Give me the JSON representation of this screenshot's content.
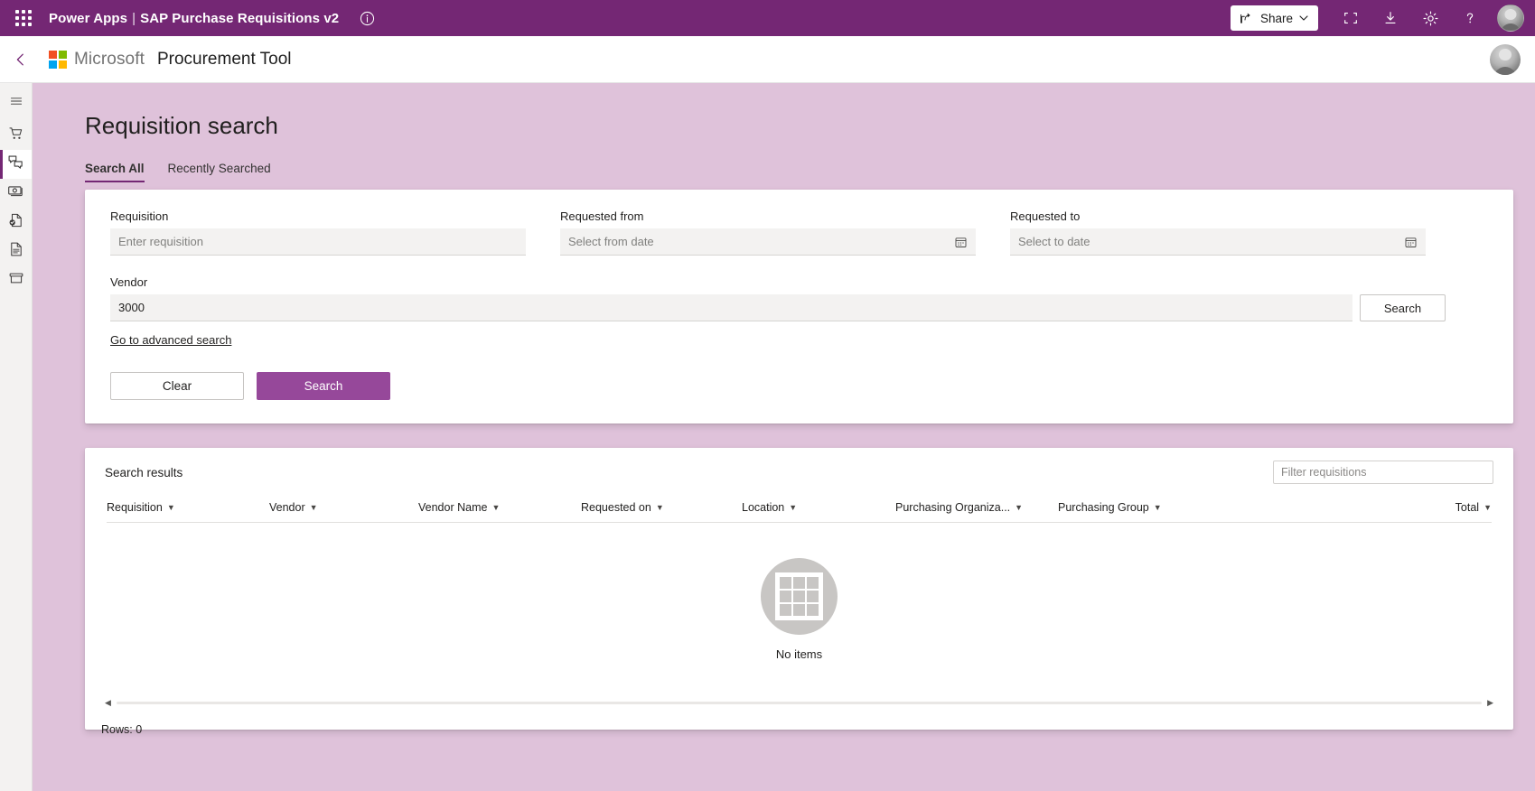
{
  "topbar": {
    "waffle_icon": "waffle-grid-icon",
    "product": "Power Apps",
    "separator": "|",
    "app_name": "SAP Purchase Requisitions v2",
    "info_icon": "info-circle-icon",
    "share_label": "Share",
    "share_icon": "share-arrow-icon",
    "share_chevron": "chevron-down-icon",
    "fullscreen_icon": "fullscreen-icon",
    "download_icon": "download-icon",
    "settings_icon": "gear-icon",
    "help_icon": "help-question-icon",
    "avatar": "user-avatar",
    "background_color": "#742774"
  },
  "appheader": {
    "back_icon": "back-chevron-icon",
    "logo": "microsoft-logo",
    "brand": "Microsoft",
    "tool_name": "Procurement Tool",
    "avatar": "user-avatar"
  },
  "sidebar": {
    "items": [
      {
        "name": "hamburger-menu",
        "icon": "hamburger-icon",
        "active": false
      },
      {
        "name": "shopping-cart",
        "icon": "cart-icon",
        "active": false
      },
      {
        "name": "requisitions",
        "icon": "speech-bubbles-icon",
        "active": true
      },
      {
        "name": "payments",
        "icon": "money-bill-icon",
        "active": false
      },
      {
        "name": "approved-document",
        "icon": "document-check-icon",
        "active": false
      },
      {
        "name": "document-list",
        "icon": "document-lines-icon",
        "active": false
      },
      {
        "name": "archive",
        "icon": "archive-box-icon",
        "active": false
      }
    ]
  },
  "main": {
    "page_title": "Requisition search",
    "tabs": [
      {
        "label": "Search All",
        "active": true
      },
      {
        "label": "Recently Searched",
        "active": false
      }
    ],
    "search_form": {
      "requisition": {
        "label": "Requisition",
        "placeholder": "Enter requisition",
        "value": ""
      },
      "requested_from": {
        "label": "Requested from",
        "placeholder": "Select from date",
        "value": "",
        "icon": "calendar-icon"
      },
      "requested_to": {
        "label": "Requested to",
        "placeholder": "Select to date",
        "value": "",
        "icon": "calendar-icon"
      },
      "vendor": {
        "label": "Vendor",
        "placeholder": "",
        "value": "3000"
      },
      "vendor_search_label": "Search",
      "advanced_link": "Go to advanced search",
      "clear_label": "Clear",
      "search_label": "Search",
      "primary_color": "#96489a"
    },
    "results": {
      "title": "Search results",
      "filter_placeholder": "Filter requisitions",
      "columns": [
        "Requisition",
        "Vendor",
        "Vendor Name",
        "Requested on",
        "Location",
        "Purchasing Organiza...",
        "Purchasing Group",
        "Total"
      ],
      "rows": [],
      "empty_text": "No items",
      "empty_icon": "grid-placeholder-icon",
      "scroll_left_icon": "triangle-left-icon",
      "scroll_right_icon": "triangle-right-icon",
      "rows_count_label": "Rows: 0"
    }
  }
}
